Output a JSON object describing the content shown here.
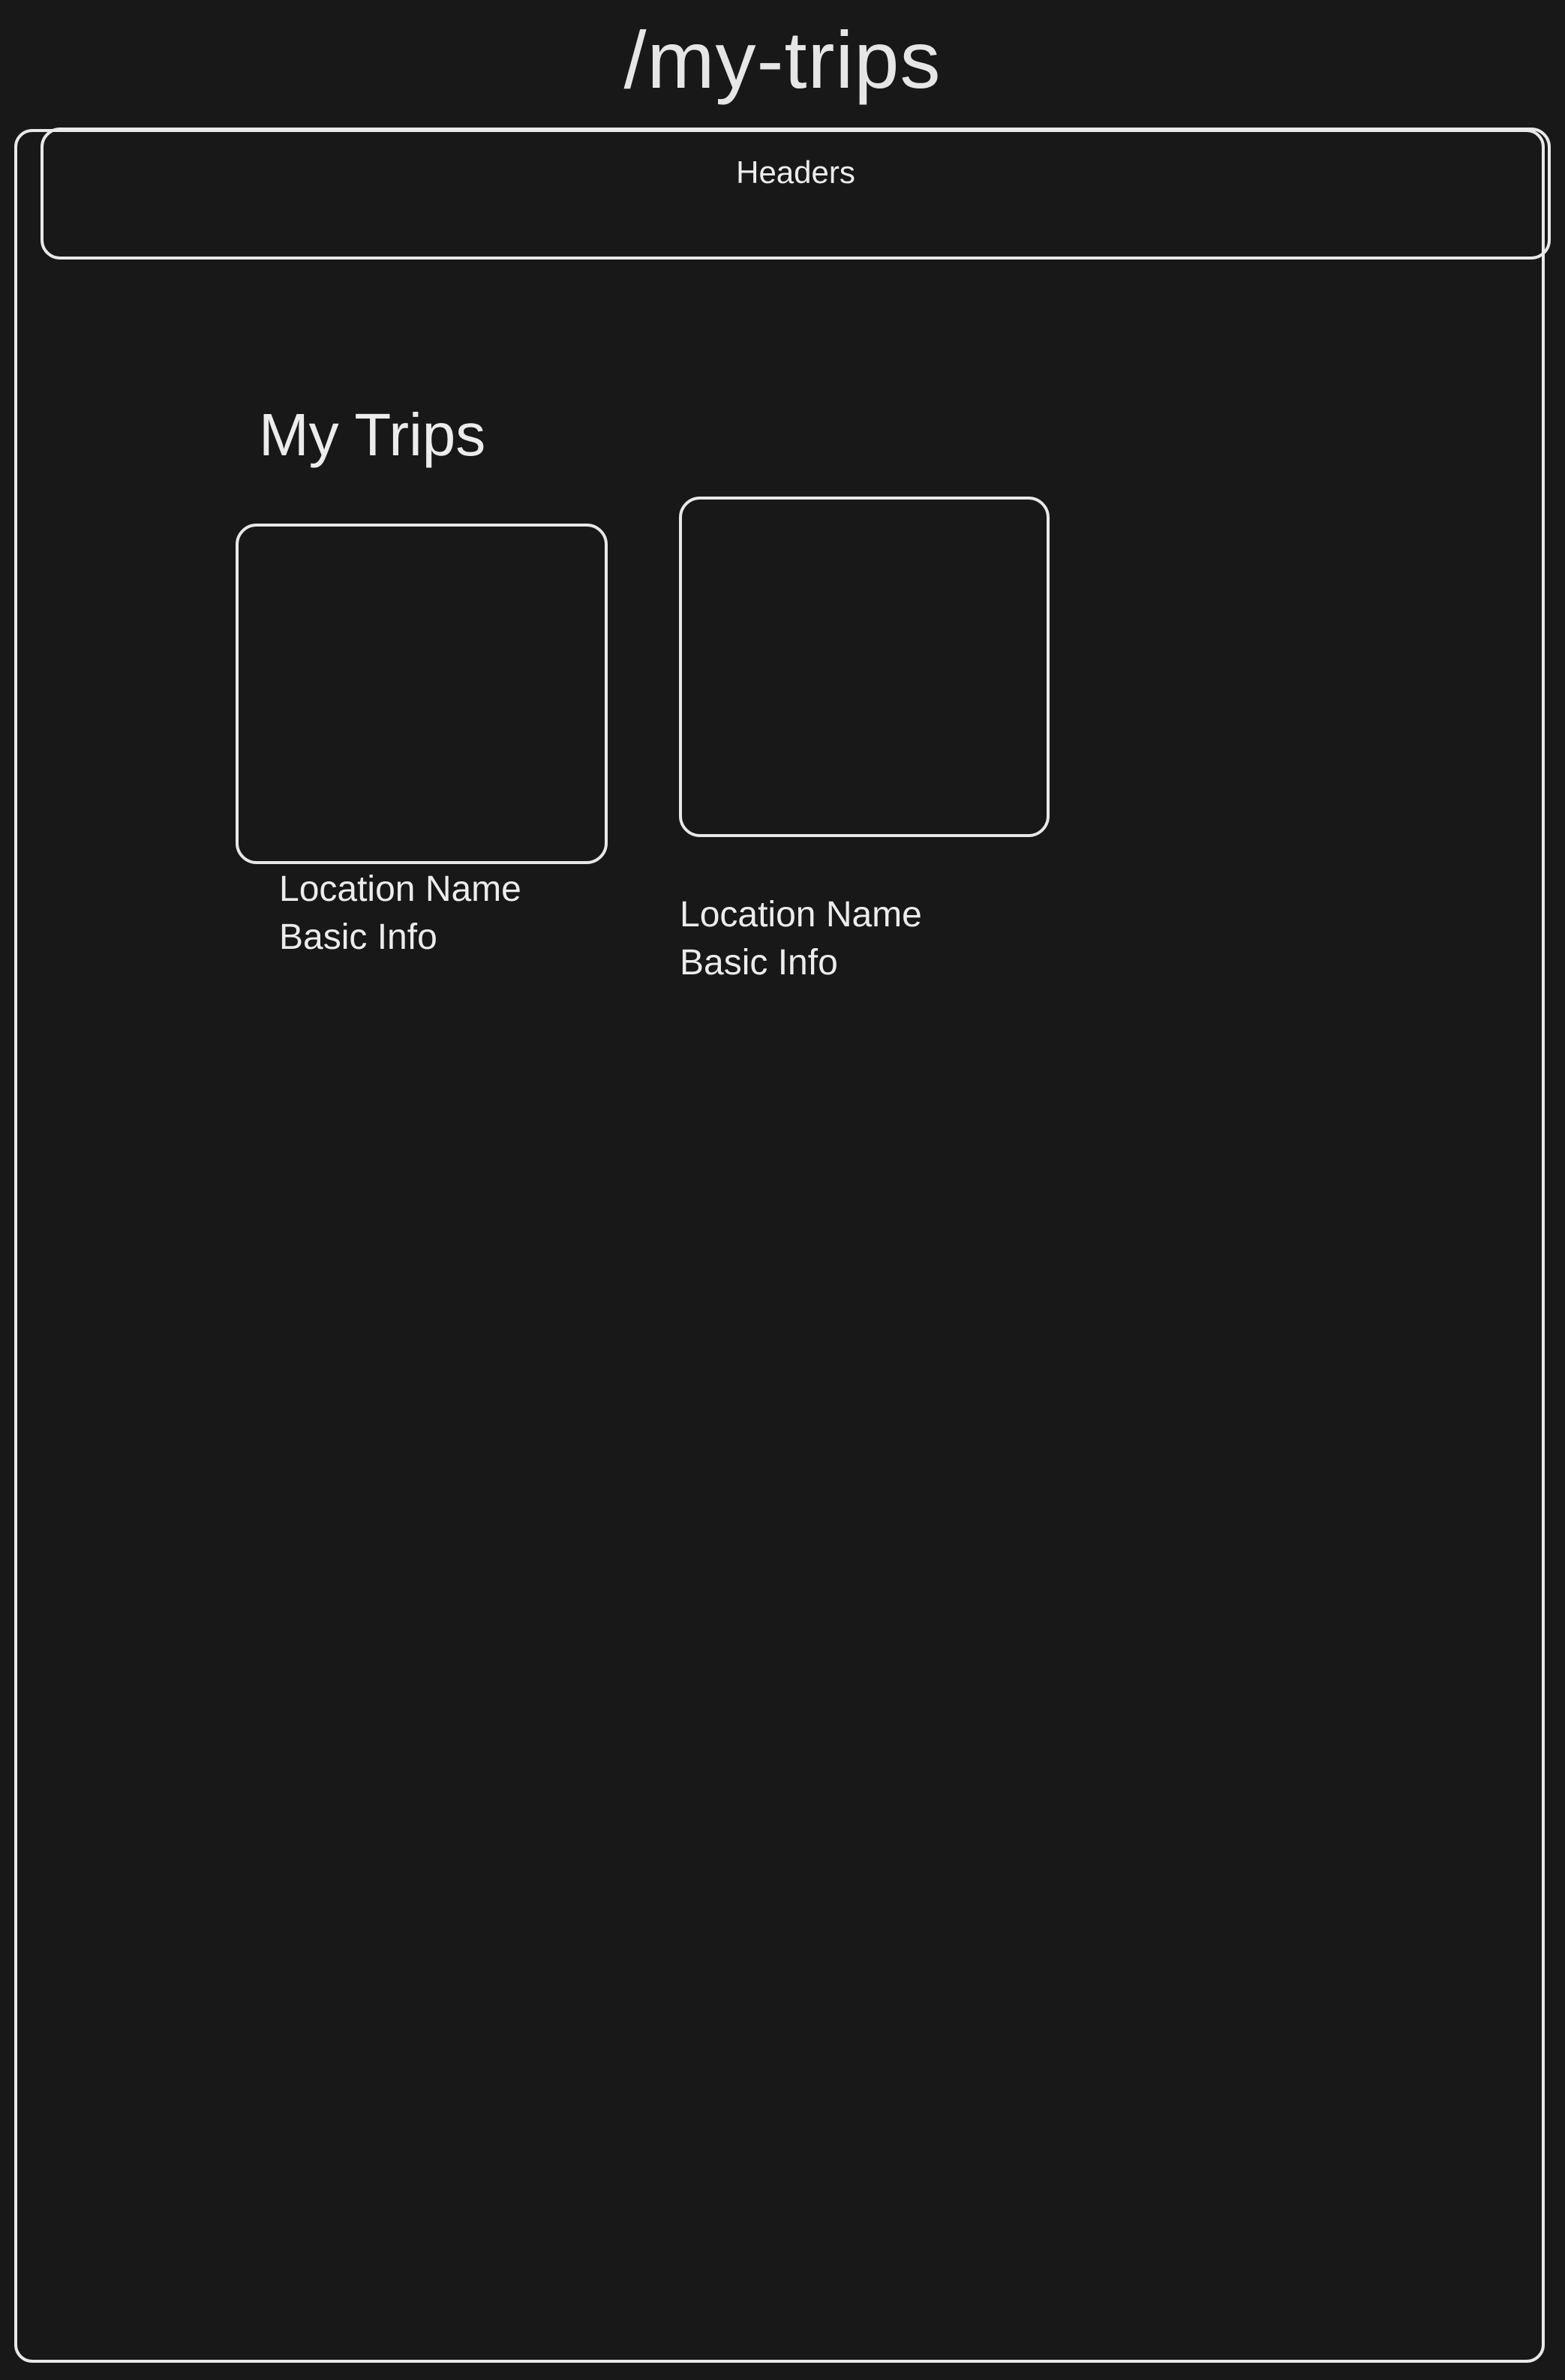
{
  "route": "/my-trips",
  "header": {
    "label": "Headers"
  },
  "page": {
    "heading": "My Trips"
  },
  "trips": [
    {
      "location_name": "Location Name",
      "basic_info": "Basic Info"
    },
    {
      "location_name": "Location Name",
      "basic_info": "Basic Info"
    }
  ],
  "colors": {
    "background": "#181818",
    "stroke": "#e8e8e8",
    "text": "#ececec"
  }
}
